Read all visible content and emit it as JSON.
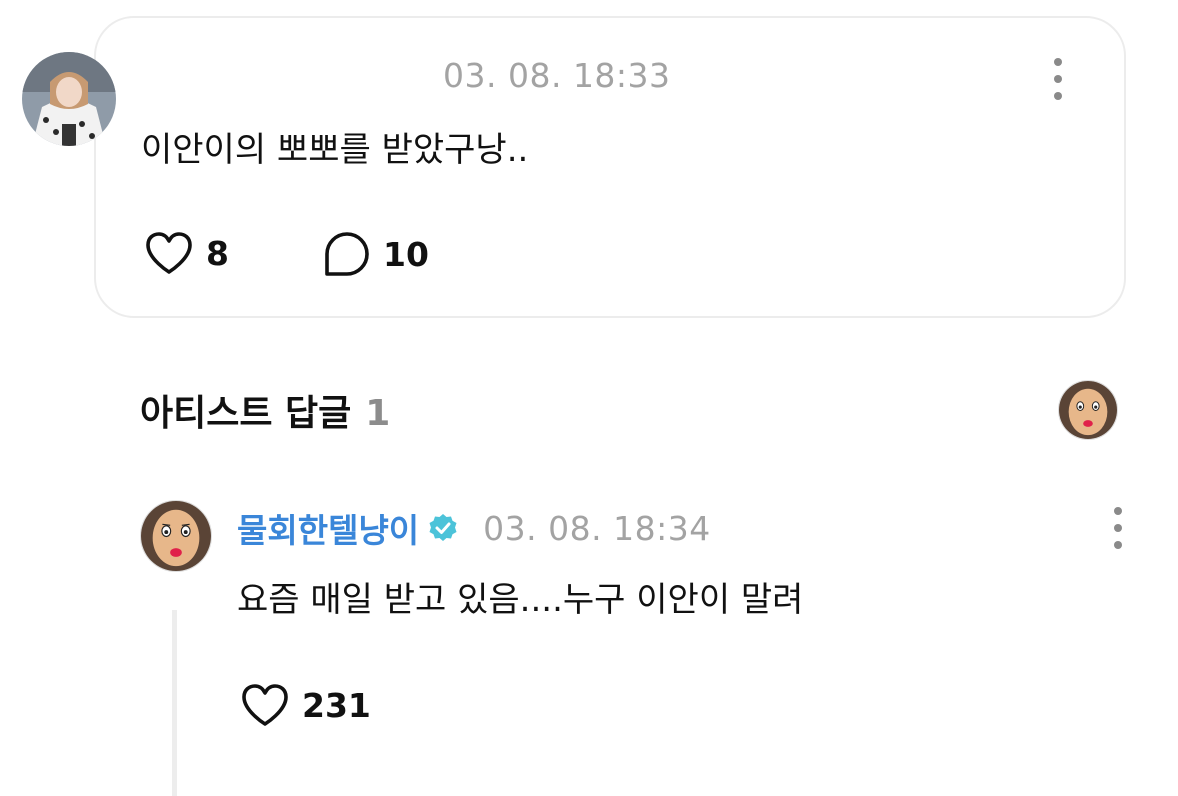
{
  "post": {
    "timestamp": "03. 08. 18:33",
    "text": "이안이의 뽀뽀를 받았구낭..",
    "like_count": "8",
    "comment_count": "10",
    "icons": {
      "like": "heart-outline-icon",
      "comment": "speech-bubble-icon",
      "more": "vertical-ellipsis-icon"
    }
  },
  "artist_replies": {
    "title": "아티스트 답글",
    "count": "1"
  },
  "reply": {
    "author": "물회한텔냥이",
    "timestamp": "03. 08. 18:34",
    "text": "요즘 매일 받고 있음....누구 이안이 말려",
    "like_count": "231",
    "verified_color": "#4cc3d9"
  },
  "colors": {
    "author_name": "#3a86d9",
    "timestamp": "#a3a3a3",
    "card_border": "#ececec",
    "count_muted": "#8c8c8c"
  }
}
